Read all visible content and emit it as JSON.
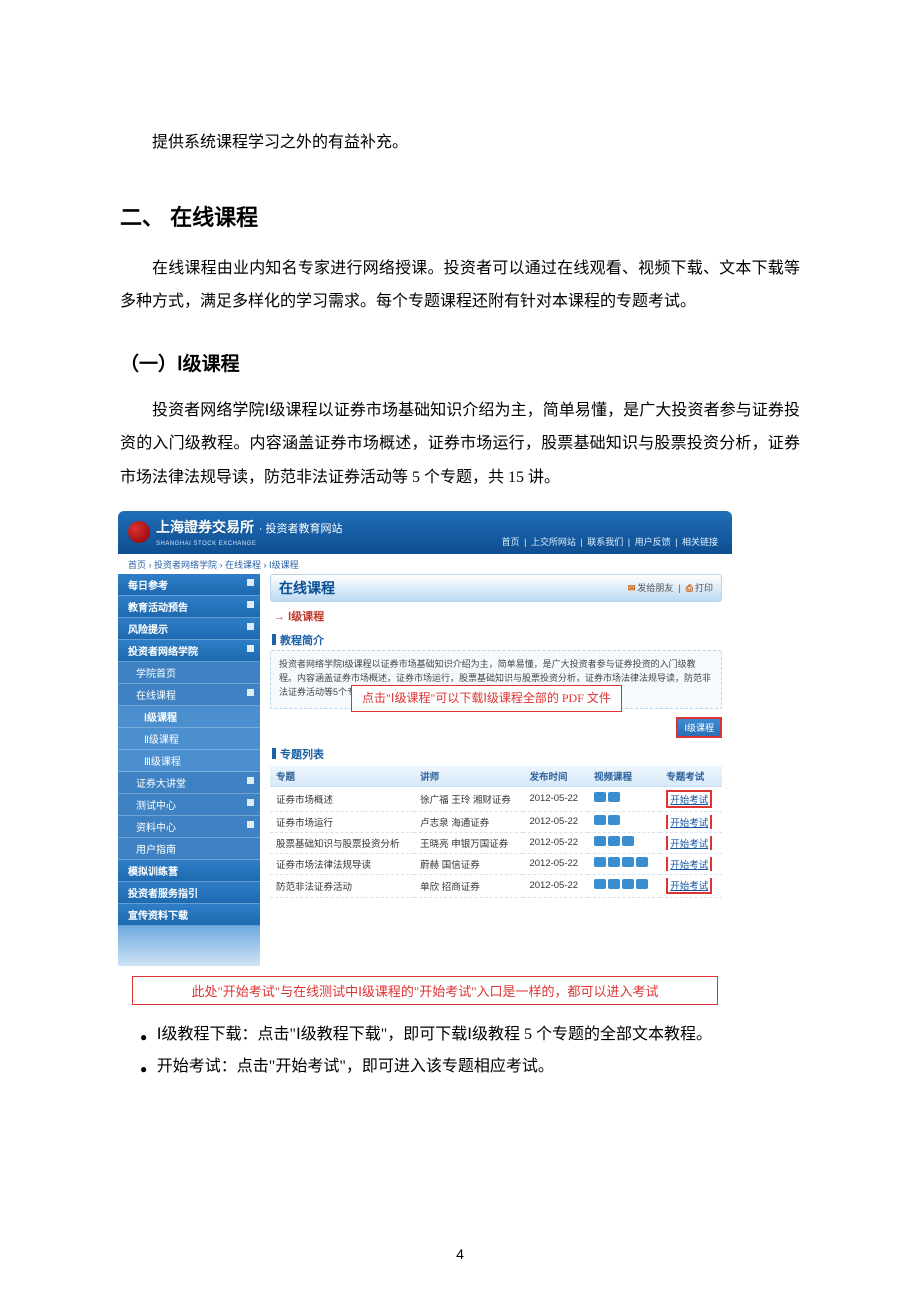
{
  "intro_line": "提供系统课程学习之外的有益补充。",
  "h2_title": "二、 在线课程",
  "para1": "在线课程由业内知名专家进行网络授课。投资者可以通过在线观看、视频下载、文本下载等多种方式，满足多样化的学习需求。每个专题课程还附有针对本课程的专题考试。",
  "h3_title": "（一）Ⅰ级课程",
  "para2": "投资者网络学院Ⅰ级课程以证券市场基础知识介绍为主，简单易懂，是广大投资者参与证券投资的入门级教程。内容涵盖证券市场概述，证券市场运行，股票基础知识与股票投资分析，证券市场法律法规导读，防范非法证券活动等 5 个专题，共 15 讲。",
  "bullets": [
    "Ⅰ级教程下载：点击\"Ⅰ级教程下载\"，即可下载Ⅰ级教程 5 个专题的全部文本教程。",
    "开始考试：点击\"开始考试\"，即可进入该专题相应考试。"
  ],
  "page_number": "4",
  "screenshot": {
    "site_brand_cn": "上海證券交易所",
    "site_brand_en": "SHANGHAI STOCK EXCHANGE",
    "site_subtitle": "· 投资者教育网站",
    "top_links": [
      "首页",
      "上交所网站",
      "联系我们",
      "用户反馈",
      "相关链接"
    ],
    "breadcrumb_label": "首页 › 投资者网络学院 › 在线课程 › Ⅰ级课程",
    "sidebar_primary": [
      {
        "label": "每日参考",
        "expand": true
      },
      {
        "label": "教育活动预告",
        "expand": true
      },
      {
        "label": "风险提示",
        "expand": true
      },
      {
        "label": "投资者网络学院",
        "expand": true
      }
    ],
    "sidebar_sub": [
      {
        "label": "学院首页"
      },
      {
        "label": "在线课程",
        "expand": true
      },
      {
        "label": "Ⅰ级课程",
        "indent": true,
        "current": true
      },
      {
        "label": "Ⅱ级课程",
        "indent": true
      },
      {
        "label": "Ⅲ级课程",
        "indent": true
      },
      {
        "label": "证券大讲堂",
        "expand": true
      },
      {
        "label": "测试中心",
        "expand": true
      },
      {
        "label": "资料中心",
        "expand": true
      },
      {
        "label": "用户指南"
      }
    ],
    "sidebar_lower": [
      {
        "label": "模拟训练营"
      },
      {
        "label": "投资者服务指引"
      },
      {
        "label": "宣传资料下载"
      }
    ],
    "main_title": "在线课程",
    "action_send": "发给朋友",
    "action_print": "打印",
    "arrow_label": "→ Ⅰ级课程",
    "section_intro_title": "教程简介",
    "intro_text": "投资者网络学院Ⅰ级课程以证券市场基础知识介绍为主，简单易懂，是广大投资者参与证券投资的入门级教程。内容涵盖证券市场概述，证券市场运行，股票基础知识与股票投资分析，证券市场法律法规导读，防范非法证券活动等5个专题，共15讲。",
    "annotation_1": "点击\"Ⅰ级课程\"可以下载Ⅰ级课程全部的 PDF 文件",
    "download_button": "Ⅰ级课程",
    "section_list_title": "专题列表",
    "table_headers": [
      "专题",
      "讲师",
      "发布时间",
      "视频课程",
      "专题考试"
    ],
    "table_rows": [
      {
        "topic": "证券市场概述",
        "lecturer": "徐广福 王玲 湘财证券",
        "date": "2012-05-22",
        "videos": 2,
        "exam": "开始考试"
      },
      {
        "topic": "证券市场运行",
        "lecturer": "卢志泉 海通证券",
        "date": "2012-05-22",
        "videos": 2,
        "exam": "开始考试"
      },
      {
        "topic": "股票基础知识与股票投资分析",
        "lecturer": "王晓亮 申银万国证券",
        "date": "2012-05-22",
        "videos": 3,
        "exam": "开始考试"
      },
      {
        "topic": "证券市场法律法规导读",
        "lecturer": "蔚赫 国信证券",
        "date": "2012-05-22",
        "videos": 4,
        "exam": "开始考试"
      },
      {
        "topic": "防范非法证券活动",
        "lecturer": "单欣 招商证券",
        "date": "2012-05-22",
        "videos": 4,
        "exam": "开始考试"
      }
    ],
    "annotation_2": "此处\"开始考试\"与在线测试中Ⅰ级课程的\"开始考试\"入口是一样的，都可以进入考试"
  }
}
